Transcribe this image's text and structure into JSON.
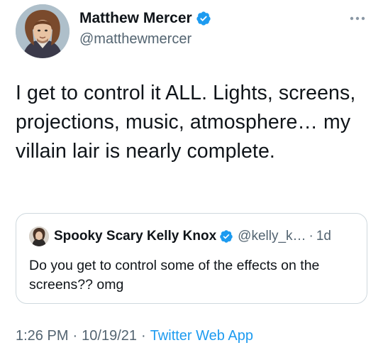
{
  "tweet": {
    "author": {
      "name": "Matthew Mercer",
      "handle": "@matthewmercer",
      "verified": true,
      "avatar_icon": "portrait-avatar"
    },
    "text": "I get to control it ALL. Lights, screens, projections, music, atmosphere… my villain lair is nearly complete.",
    "more_icon": "ellipsis-icon",
    "quoted": {
      "author": {
        "name": "Spooky Scary Kelly Knox",
        "handle": "@kelly_k…",
        "verified": true,
        "avatar_icon": "portrait-avatar"
      },
      "separator": "·",
      "time": "1d",
      "text": "Do you get to control some of the effects on the screens?? omg"
    },
    "meta": {
      "time": "1:26 PM",
      "separator_1": "·",
      "date": "10/19/21",
      "separator_2": "·",
      "source": "Twitter Web App"
    }
  },
  "colors": {
    "text_primary": "#0f1419",
    "text_secondary": "#536471",
    "verified_blue": "#1d9bf0",
    "link_blue": "#1d9bf0",
    "border": "#cfd9de"
  }
}
